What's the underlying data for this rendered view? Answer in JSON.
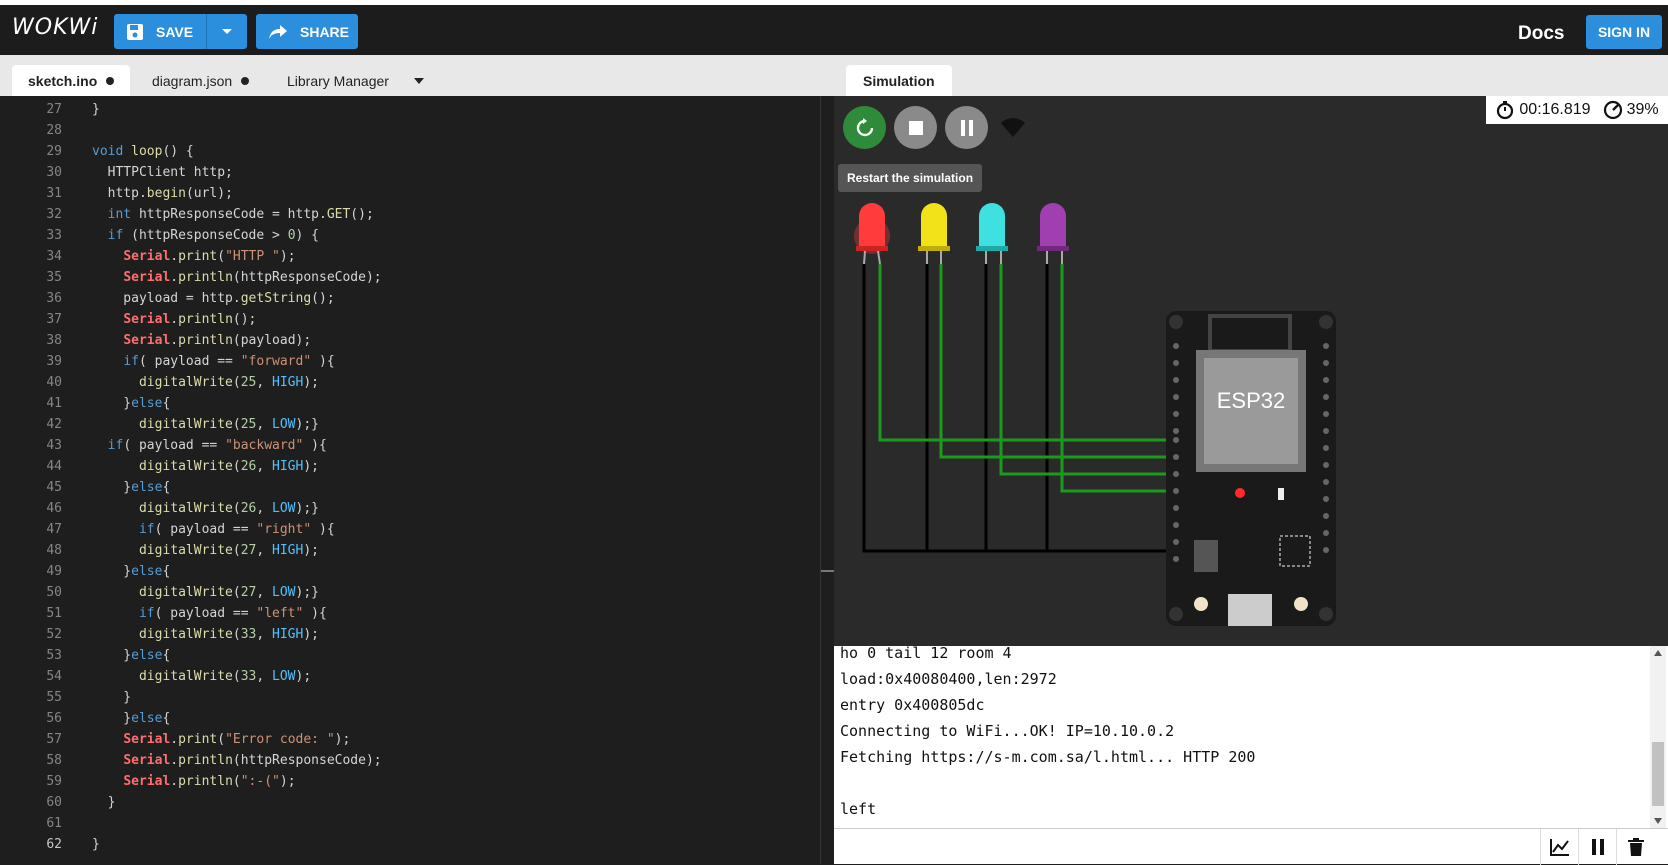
{
  "header": {
    "logo": "WOKWi",
    "save_label": "SAVE",
    "share_label": "SHARE",
    "docs_label": "Docs",
    "signin_label": "SIGN IN"
  },
  "tabs": [
    {
      "label": "sketch.ino"
    },
    {
      "label": "diagram.json"
    },
    {
      "label": "Library Manager"
    }
  ],
  "simulation_tab": {
    "label": "Simulation"
  },
  "sim": {
    "timer": "00:16.819",
    "speed": "39%",
    "tooltip": "Restart the simulation",
    "chip_label": "ESP32"
  },
  "editor": {
    "line_numbers": [
      "27",
      "28",
      "29",
      "30",
      "31",
      "32",
      "33",
      "34",
      "35",
      "36",
      "37",
      "38",
      "39",
      "40",
      "41",
      "42",
      "43",
      "44",
      "45",
      "46",
      "47",
      "48",
      "49",
      "50",
      "51",
      "52",
      "53",
      "54",
      "55",
      "56",
      "57",
      "58",
      "59",
      "60",
      "61",
      "62"
    ],
    "lines": [
      "}",
      "",
      "void loop() {",
      "  HTTPClient http;",
      "  http.begin(url);",
      "  int httpResponseCode = http.GET();",
      "  if (httpResponseCode > 0) {",
      "    Serial.print(\"HTTP \");",
      "    Serial.println(httpResponseCode);",
      "    payload = http.getString();",
      "    Serial.println();",
      "    Serial.println(payload);",
      "    if( payload == \"forward\" ){",
      "      digitalWrite(25, HIGH);",
      "    }else{",
      "      digitalWrite(25, LOW);}",
      "  if( payload == \"backward\" ){",
      "      digitalWrite(26, HIGH);",
      "    }else{",
      "      digitalWrite(26, LOW);}",
      "      if( payload == \"right\" ){",
      "      digitalWrite(27, HIGH);",
      "    }else{",
      "      digitalWrite(27, LOW);}",
      "      if( payload == \"left\" ){",
      "      digitalWrite(33, HIGH);",
      "    }else{",
      "      digitalWrite(33, LOW);",
      "    }",
      "    }else{",
      "    Serial.print(\"Error code: \");",
      "    Serial.println(httpResponseCode);",
      "    Serial.println(\":-(\");",
      "  }",
      "",
      "}"
    ]
  },
  "serial": {
    "lines": [
      "ho 0 tail 12 room 4",
      "load:0x40080400,len:2972",
      "entry 0x400805dc",
      "Connecting to WiFi...OK! IP=10.10.0.2",
      "Fetching https://s-m.com.sa/l.html... HTTP 200",
      "",
      "left"
    ]
  },
  "leds": [
    {
      "color": "#ff3b3b"
    },
    {
      "color": "#f2e21a"
    },
    {
      "color": "#3fe0e0"
    },
    {
      "color": "#a040b0"
    }
  ],
  "colors": {
    "accent": "#2b8fde",
    "restart": "#2e8b3a",
    "wire_green": "#1d9a1d"
  }
}
